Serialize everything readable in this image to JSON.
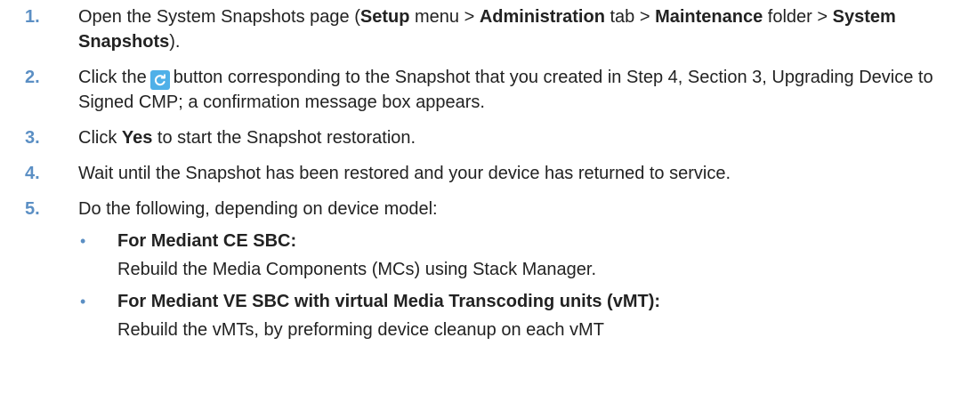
{
  "steps": [
    {
      "num": "1.",
      "p1": "Open the System Snapshots page (",
      "b1": "Setup",
      "p2": " menu > ",
      "b2": "Administration",
      "p3": " tab > ",
      "b3": "Maintenance",
      "p4": " folder > ",
      "b4": "System Snapshots",
      "p5": ")."
    },
    {
      "num": "2.",
      "p1": "Click the",
      "p2": "button corresponding to the Snapshot that you created in Step 4, Section 3, Upgrading Device to Signed CMP; a confirmation message box appears."
    },
    {
      "num": "3.",
      "p1": "Click ",
      "b1": "Yes",
      "p2": " to start the Snapshot restoration."
    },
    {
      "num": "4.",
      "text": "Wait until the Snapshot has been restored and your device has returned to service."
    },
    {
      "num": "5.",
      "text": "Do the following, depending on device model:"
    }
  ],
  "bullets": [
    {
      "symbol": "•",
      "heading": "For Mediant CE SBC:",
      "body": "Rebuild the Media Components (MCs) using Stack Manager."
    },
    {
      "symbol": "•",
      "heading": "For Mediant VE SBC with virtual Media Transcoding units (vMT):",
      "body": "Rebuild the vMTs, by preforming device cleanup on each vMT"
    }
  ],
  "colors": {
    "number": "#5b8fc4",
    "refresh_button": "#4fb0e8"
  },
  "icons": {
    "refresh": "refresh-icon"
  }
}
